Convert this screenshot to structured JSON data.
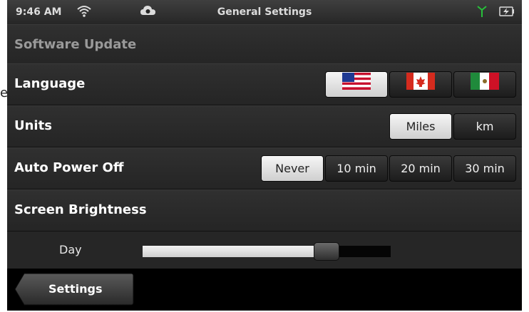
{
  "status": {
    "time": "9:46 AM",
    "title": "General Settings",
    "icons": [
      "wifi-icon",
      "cloud-sync-icon",
      "antenna-icon",
      "battery-charging-icon"
    ],
    "signal_color": "#27c13a"
  },
  "rows": {
    "software_update": "Software Update",
    "language": {
      "label": "Language",
      "options": [
        "us-flag-icon",
        "canada-flag-icon",
        "mexico-flag-icon"
      ],
      "selected": 0
    },
    "units": {
      "label": "Units",
      "options": [
        "Miles",
        "km"
      ],
      "selected": "Miles"
    },
    "auto_power_off": {
      "label": "Auto Power Off",
      "options": [
        "Never",
        "10 min",
        "20 min",
        "30 min"
      ],
      "selected": "Never"
    },
    "screen_brightness": "Screen Brightness"
  },
  "brightness": {
    "label": "Day",
    "level": 0.74
  },
  "bottom": {
    "back_label": "Settings"
  },
  "stray_char": "e"
}
